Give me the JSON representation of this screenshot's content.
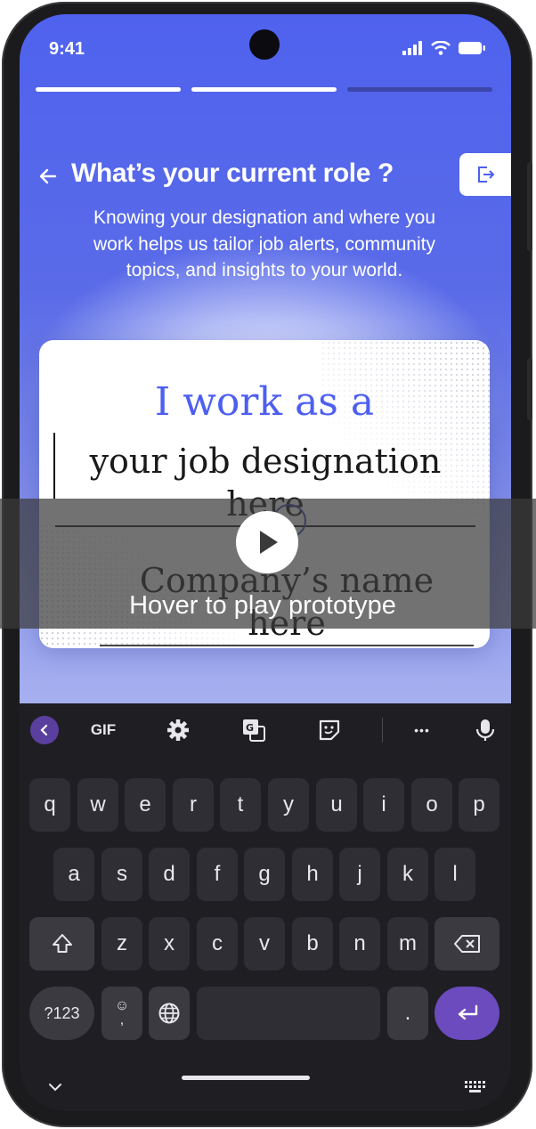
{
  "status_bar": {
    "time": "9:41"
  },
  "onboarding": {
    "title": "What’s your current role ?",
    "subtitle": "Knowing your designation and where you work helps us tailor job alerts, community topics, and insights to your world.",
    "progress": {
      "completed_steps": 2,
      "total_steps": 3
    }
  },
  "card": {
    "lead": "I work as a",
    "designation_placeholder": "your job designation here",
    "company_placeholder": "Company’s name here"
  },
  "overlay": {
    "label": "Hover to play prototype"
  },
  "keyboard": {
    "toolbar": {
      "gif_label": "GIF",
      "more_label": "•••"
    },
    "row1": [
      "q",
      "w",
      "e",
      "r",
      "t",
      "y",
      "u",
      "i",
      "o",
      "p"
    ],
    "row2": [
      "a",
      "s",
      "d",
      "f",
      "g",
      "h",
      "j",
      "k",
      "l"
    ],
    "row3": [
      "z",
      "x",
      "c",
      "v",
      "b",
      "n",
      "m"
    ],
    "symbols_label": "?123",
    "emoji_label": "☺",
    "comma_label": ",",
    "period_label": "."
  },
  "colors": {
    "accent": "#4d5ff0",
    "keyboard_accent": "#6b4bbd"
  }
}
